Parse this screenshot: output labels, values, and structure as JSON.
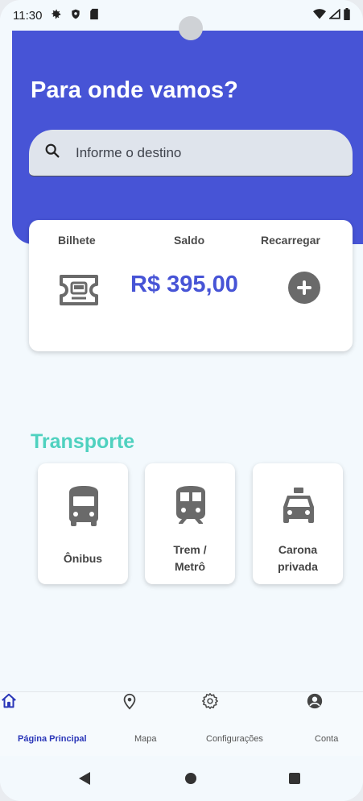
{
  "status_bar": {
    "time": "11:30"
  },
  "header": {
    "title": "Para onde vamos?",
    "search_placeholder": "Informe o destino"
  },
  "ticket_card": {
    "bilhete_label": "Bilhete",
    "saldo_label": "Saldo",
    "recarregar_label": "Recarregar",
    "balance": "R$ 395,00"
  },
  "transport": {
    "title": "Transporte",
    "items": [
      {
        "line1": "Ônibus",
        "line2": ""
      },
      {
        "line1": "Trem /",
        "line2": "Metrô"
      },
      {
        "line1": "Carona",
        "line2": "privada"
      }
    ]
  },
  "bottom_nav": {
    "items": [
      {
        "label": "Página Principal",
        "icon": "home-icon"
      },
      {
        "label": "Mapa",
        "icon": "map-pin-icon"
      },
      {
        "label": "Configurações",
        "icon": "gear-icon"
      },
      {
        "label": "Conta",
        "icon": "account-icon"
      }
    ]
  },
  "colors": {
    "primary": "#4754d6",
    "accent": "#4fd1bf",
    "nav_active": "#2a36b8",
    "background": "#f3f9fd"
  }
}
